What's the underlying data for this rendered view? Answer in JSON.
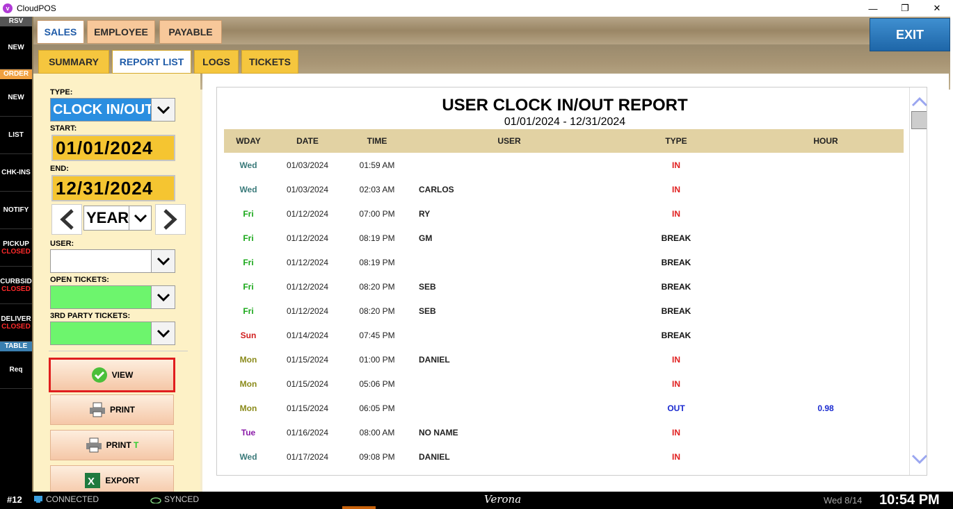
{
  "window": {
    "title": "CloudPOS",
    "icon_letter": "v"
  },
  "leftnav": {
    "headers": {
      "rsv": "RSV",
      "order": "ORDER",
      "table": "TABLE"
    },
    "items": {
      "rsv_new": "NEW",
      "order_new": "NEW",
      "list": "LIST",
      "chkins": "CHK-INS",
      "notify": "NOTIFY",
      "pickup": "PICKUP",
      "pickup_status": "CLOSED",
      "curbside": "CURBSID",
      "curbside_status": "CLOSED",
      "delivery": "DELIVER",
      "delivery_status": "CLOSED",
      "req": "Req"
    }
  },
  "tabs": {
    "main": [
      "SALES",
      "EMPLOYEE",
      "PAYABLE"
    ],
    "sub": [
      "SUMMARY",
      "REPORT LIST",
      "LOGS",
      "TICKETS"
    ]
  },
  "exit_label": "EXIT",
  "filters": {
    "type_label": "TYPE:",
    "type_value": "CLOCK IN/OUT",
    "start_label": "START:",
    "start_value": "01/01/2024",
    "end_label": "END:",
    "end_value": "12/31/2024",
    "period_value": "YEAR",
    "user_label": "USER:",
    "user_value": "",
    "open_tickets_label": "OPEN TICKETS:",
    "third_party_label": "3RD PARTY TICKETS:"
  },
  "buttons": {
    "view": "VIEW",
    "print": "PRINT",
    "print_t_prefix": "PRINT",
    "print_t_suffix": "T",
    "export": "EXPORT"
  },
  "report": {
    "title": "USER CLOCK IN/OUT REPORT",
    "range": "01/01/2024 - 12/31/2024",
    "columns": [
      "WDAY",
      "DATE",
      "TIME",
      "USER",
      "TYPE",
      "HOUR"
    ],
    "rows": [
      {
        "wday": "Wed",
        "date": "01/03/2024",
        "time": "01:59 AM",
        "user": "",
        "type": "IN",
        "hour": ""
      },
      {
        "wday": "Wed",
        "date": "01/03/2024",
        "time": "02:03 AM",
        "user": "CARLOS",
        "type": "IN",
        "hour": ""
      },
      {
        "wday": "Fri",
        "date": "01/12/2024",
        "time": "07:00 PM",
        "user": "RY",
        "type": "IN",
        "hour": ""
      },
      {
        "wday": "Fri",
        "date": "01/12/2024",
        "time": "08:19 PM",
        "user": "GM",
        "type": "BREAK",
        "hour": ""
      },
      {
        "wday": "Fri",
        "date": "01/12/2024",
        "time": "08:19 PM",
        "user": "",
        "type": "BREAK",
        "hour": ""
      },
      {
        "wday": "Fri",
        "date": "01/12/2024",
        "time": "08:20 PM",
        "user": "SEB",
        "type": "BREAK",
        "hour": ""
      },
      {
        "wday": "Fri",
        "date": "01/12/2024",
        "time": "08:20 PM",
        "user": "SEB",
        "type": "BREAK",
        "hour": ""
      },
      {
        "wday": "Sun",
        "date": "01/14/2024",
        "time": "07:45 PM",
        "user": "",
        "type": "BREAK",
        "hour": ""
      },
      {
        "wday": "Mon",
        "date": "01/15/2024",
        "time": "01:00 PM",
        "user": "DANIEL",
        "type": "IN",
        "hour": ""
      },
      {
        "wday": "Mon",
        "date": "01/15/2024",
        "time": "05:06 PM",
        "user": "",
        "type": "IN",
        "hour": ""
      },
      {
        "wday": "Mon",
        "date": "01/15/2024",
        "time": "06:05 PM",
        "user": "",
        "type": "OUT",
        "hour": "0.98"
      },
      {
        "wday": "Tue",
        "date": "01/16/2024",
        "time": "08:00 AM",
        "user": "NO NAME",
        "type": "IN",
        "hour": ""
      },
      {
        "wday": "Wed",
        "date": "01/17/2024",
        "time": "09:08 PM",
        "user": "DANIEL",
        "type": "IN",
        "hour": ""
      }
    ],
    "wday_colors": {
      "Mon": "#8a8a1a",
      "Tue": "#8a1aa8",
      "Wed": "#3a7a7a",
      "Fri": "#1aa81a",
      "Sun": "#d01e1e"
    }
  },
  "status": {
    "station": "#12",
    "connected": "CONNECTED",
    "synced": "SYNCED",
    "store": "Verona",
    "date": "Wed 8/14",
    "time": "10:54 PM"
  }
}
